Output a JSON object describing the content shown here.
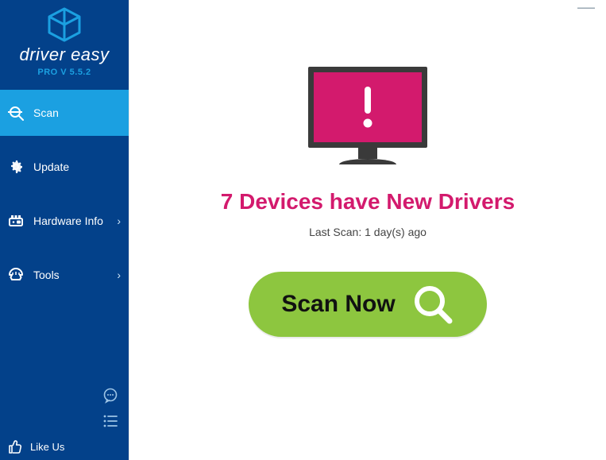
{
  "brand": "driver easy",
  "version": "PRO V 5.5.2",
  "nav": {
    "scan": "Scan",
    "update": "Update",
    "hardware": "Hardware Info",
    "tools": "Tools"
  },
  "likeus": "Like Us",
  "main": {
    "headline": "7 Devices have New Drivers",
    "last_scan": "Last Scan: 1 day(s) ago",
    "scan_button": "Scan Now"
  }
}
